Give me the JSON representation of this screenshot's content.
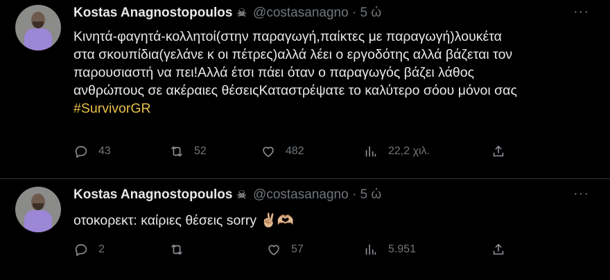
{
  "tweets": [
    {
      "name": "Kostas Anagnostopoulos",
      "badge": "☠",
      "handle": "@costasanagno",
      "separator": "·",
      "time": "5 ώ",
      "more": "···",
      "lines": [
        "Κινητά-φαγητά-κολλητοί(στην παραγωγή,παίκτες με παραγωγή)λουκέτα",
        "στα σκουπίδια(γελάνε κ οι πέτρες)αλλά λέει ο εργοδότης αλλά βάζεται τον",
        "παρουσιαστή να πει!Αλλά έτσι πάει όταν ο παραγωγός βάζει λάθος",
        "ανθρώπους σε ακέραιες θέσειςΚαταστρέψατε το καλύτερο σόου μόνοι σας"
      ],
      "hashtag": "#SurvivorGR",
      "replies": "43",
      "retweets": "52",
      "likes": "482",
      "views": "22,2 χιλ."
    },
    {
      "name": "Kostas Anagnostopoulos",
      "badge": "☠",
      "handle": "@costasanagno",
      "separator": "·",
      "time": "5 ώ",
      "more": "···",
      "text": "οτοκορεκτ: καίριες θέσεις sorry ✌🏼🫶🏼",
      "replies": "2",
      "retweets": "",
      "likes": "57",
      "views": "5.951"
    }
  ],
  "colors": {
    "background": "#000000",
    "text": "#e7e9ea",
    "muted": "#71767b",
    "hashtag": "#e8c04a"
  }
}
